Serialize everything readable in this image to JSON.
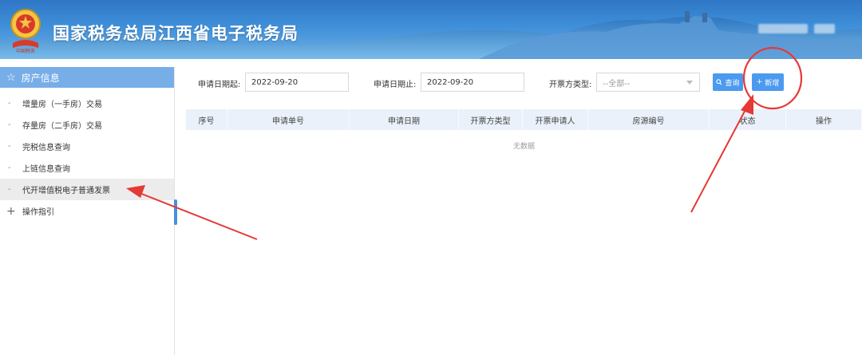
{
  "header": {
    "title": "国家税务总局江西省电子税务局"
  },
  "sidebar": {
    "heading": "房产信息",
    "items": [
      {
        "label": "增量房（一手房）交易"
      },
      {
        "label": "存量房（二手房）交易"
      },
      {
        "label": "完税信息查询"
      },
      {
        "label": "上链信息查询"
      },
      {
        "label": "代开增值税电子普通发票",
        "active": true
      }
    ],
    "group": "操作指引"
  },
  "filters": {
    "start_label": "申请日期起:",
    "start_value": "2022-09-20",
    "end_label": "申请日期止:",
    "end_value": "2022-09-20",
    "issuer_label": "开票方类型:",
    "issuer_value": "--全部--",
    "query_button": "查询",
    "add_button": "新增"
  },
  "table": {
    "columns": [
      "序号",
      "申请单号",
      "申请日期",
      "开票方类型",
      "开票申请人",
      "房源编号",
      "状态",
      "操作"
    ],
    "empty_text": "无数据"
  },
  "colors": {
    "header_bg": "#3f8fd9",
    "sidebar_active_head": "#78aee8",
    "button": "#4b9af0",
    "annotation": "#e53935"
  },
  "icons": {
    "emblem": "tax-emblem-icon",
    "star": "star-icon",
    "plus": "plus-icon",
    "search": "search-icon"
  }
}
